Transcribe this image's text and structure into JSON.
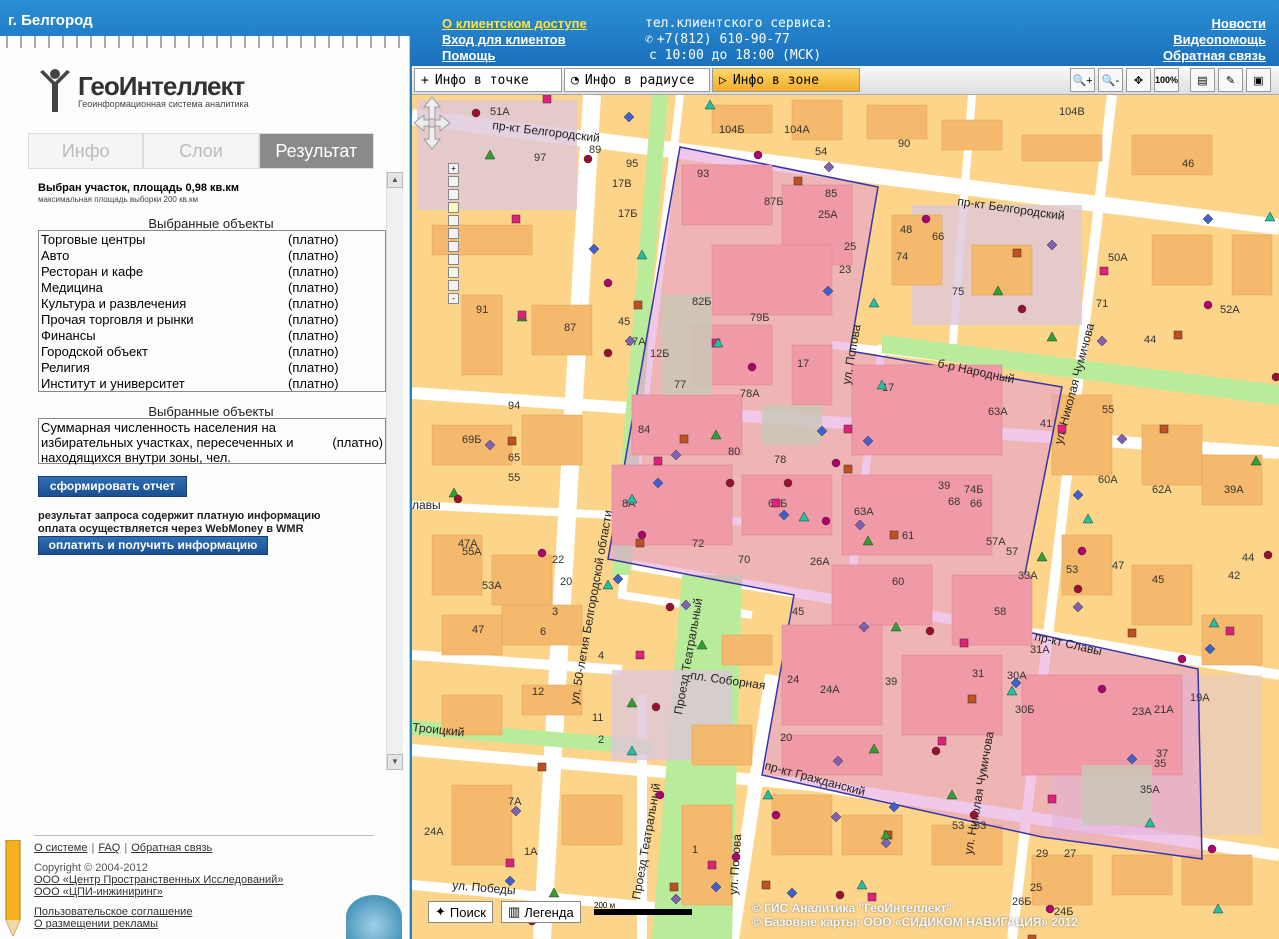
{
  "header": {
    "city": "г. Белгород",
    "links_left": [
      "О клиентском доступе",
      "Вход для клиентов",
      "Помощь"
    ],
    "phone_label": "тел.клиентского сервиса:",
    "phone": "+7(812) 610-90-77",
    "hours": "с 10:00 до 18:00 (МСК)",
    "links_right": [
      "Новости",
      "Видеопомощь",
      "Обратная связь"
    ]
  },
  "logo": {
    "name": "ГеоИнтеллект",
    "subtitle": "Геоинформационная система аналитика"
  },
  "tabs": [
    {
      "label": "Инфо",
      "active": false
    },
    {
      "label": "Слои",
      "active": false
    },
    {
      "label": "Результат",
      "active": true
    }
  ],
  "result": {
    "selection_title": "Выбран участок, площадь 0,98 кв.км",
    "selection_subtitle": "максимальная площадь выборки 200 кв.км",
    "objects_title": "Выбранные объекты",
    "objects": [
      {
        "name": "Торговые центры",
        "price": "(платно)"
      },
      {
        "name": "Авто",
        "price": "(платно)"
      },
      {
        "name": "Ресторан и кафе",
        "price": "(платно)"
      },
      {
        "name": "Медицина",
        "price": "(платно)"
      },
      {
        "name": "Культура и развлечения",
        "price": "(платно)"
      },
      {
        "name": "Прочая торговля и рынки",
        "price": "(платно)"
      },
      {
        "name": "Финансы",
        "price": "(платно)"
      },
      {
        "name": "Городской объект",
        "price": "(платно)"
      },
      {
        "name": "Религия",
        "price": "(платно)"
      },
      {
        "name": "Институт и университет",
        "price": "(платно)"
      }
    ],
    "objects2_title": "Выбранные объекты",
    "population_text": "Суммарная численность населения на избирательных участках, пересеченных и находящихся внутри зоны, чел.",
    "population_price": "(платно)",
    "report_button": "сформировать отчет",
    "note_line1": "результат запроса содержит платную информацию",
    "note_line2": "оплата осуществляется через WebMoney в WMR",
    "pay_button": "оплатить и получить информацию"
  },
  "footer": {
    "links": [
      "О системе",
      "FAQ",
      "Обратная связь"
    ],
    "copyright": "Copyright © 2004-2012",
    "orgs": [
      "ООО «Центр Пространственных Исследований»",
      "ООО «ЦПИ-инжиниринг»"
    ],
    "agreement": "Пользовательское соглашение",
    "ads": "О размещении рекламы"
  },
  "toolbar": {
    "info_point": "Инфо в точке",
    "info_radius": "Инфо в радиусе",
    "info_zone": "Инфо в зоне",
    "zoom_100": "100%"
  },
  "map": {
    "streets": {
      "belgorodsky1": "пр-кт Белгородский",
      "belgorodsky2": "пр-кт Белгородский",
      "narodny": "б-р Народный",
      "chumicheva1": "ул. Николая Чумичова",
      "chumicheva2": "ул. Николая Чумичова",
      "popova1": "ул. Попова",
      "popova2": "ул. Попова",
      "slavy1": "пр-кт Славы",
      "slavy2": "лавы",
      "fifty": "ул. 50-летия Белгородской области",
      "teatr1": "Проезд Театральный",
      "teatr2": "Проезд Театральный",
      "sobornaya": "пл. Соборная",
      "troitsky": "Троицкий",
      "grazhd": "пр-кт Гражданский",
      "pobedy": "ул. Победы"
    },
    "house_numbers": [
      "93",
      "85",
      "87Б",
      "25А",
      "25",
      "23",
      "82Б",
      "79Б",
      "12Б",
      "17",
      "77",
      "78А",
      "84",
      "80",
      "78",
      "8А",
      "72",
      "70",
      "69Б",
      "63А",
      "61",
      "60",
      "57А",
      "57",
      "66",
      "26А",
      "33А",
      "58",
      "45",
      "24",
      "24А",
      "39",
      "31",
      "31А",
      "30А",
      "30Б",
      "23А",
      "21А",
      "19А",
      "37",
      "35",
      "35А",
      "20",
      "53",
      "51А",
      "104В",
      "104Б",
      "104А",
      "54",
      "90",
      "95",
      "97",
      "89",
      "17В",
      "17Б",
      "91",
      "87",
      "94",
      "69Б",
      "65",
      "55",
      "55А",
      "53А",
      "47А",
      "47",
      "45",
      "17А",
      "17",
      "63А",
      "41",
      "39",
      "74Б",
      "68",
      "66",
      "75",
      "74",
      "48",
      "50А",
      "71",
      "44",
      "46",
      "52А",
      "55",
      "60А",
      "62А",
      "39А",
      "53",
      "47",
      "45",
      "42",
      "44",
      "1",
      "7А",
      "1А",
      "53",
      "29",
      "27",
      "25",
      "26Б",
      "24Б",
      "24А",
      "11",
      "2",
      "4",
      "6",
      "12",
      "3",
      "20",
      "22"
    ],
    "scale": "200 м",
    "search": "Поиск",
    "legend": "Легенда",
    "copyright1": "© ГИС Аналитика \"ГеоИнтеллект\"",
    "copyright2": "© Базовые карты: ООО «СИДИКОМ НАВИГАЦИЯ» 2012"
  },
  "colors": {
    "header_blue": "#1f7fc8",
    "map_block": "#fcd58a",
    "map_building": "#f4b96d",
    "map_road": "#ffffff",
    "map_green": "#b9ec9a",
    "zone_fill": "#e49ad8",
    "zone_border": "#3535a8",
    "tab_active": "#8a8a8a",
    "button_blue": "#1f5da0",
    "zone_button_active": "#f5b93a"
  }
}
